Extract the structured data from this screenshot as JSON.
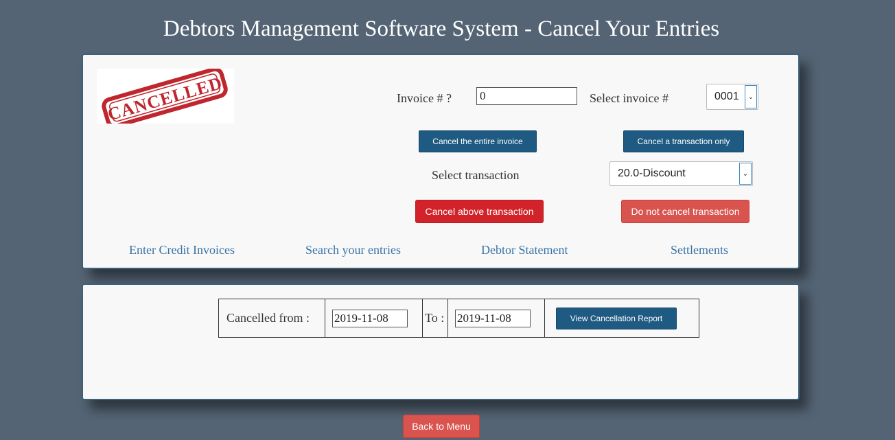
{
  "title": "Debtors Management Software System - Cancel Your Entries",
  "stamp_text": "CANCELLED",
  "invoice": {
    "label": "Invoice # ?",
    "value": "0",
    "select_label": "Select invoice #",
    "select_value": "0001"
  },
  "buttons": {
    "cancel_invoice": "Cancel the entire invoice",
    "cancel_transaction_only": "Cancel a transaction only",
    "cancel_above": "Cancel above transaction",
    "do_not_cancel": "Do not cancel transaction",
    "view_report": "View Cancellation Report",
    "back_menu": "Back to Menu"
  },
  "transaction": {
    "label": "Select transaction",
    "value": "20.0-Discount"
  },
  "nav": [
    "Enter Credit Invoices",
    "Search your entries",
    "Debtor Statement",
    "Settlements"
  ],
  "report": {
    "from_label": "Cancelled from :",
    "from_value": "2019-11-08",
    "to_label": "To :",
    "to_value": "2019-11-08"
  },
  "colors": {
    "background": "#546474",
    "panel": "#f8f8f8",
    "blue_button": "#1e5a82",
    "red_button": "#d2232a",
    "pink_button": "#d9534f",
    "link": "#3a73a6"
  }
}
